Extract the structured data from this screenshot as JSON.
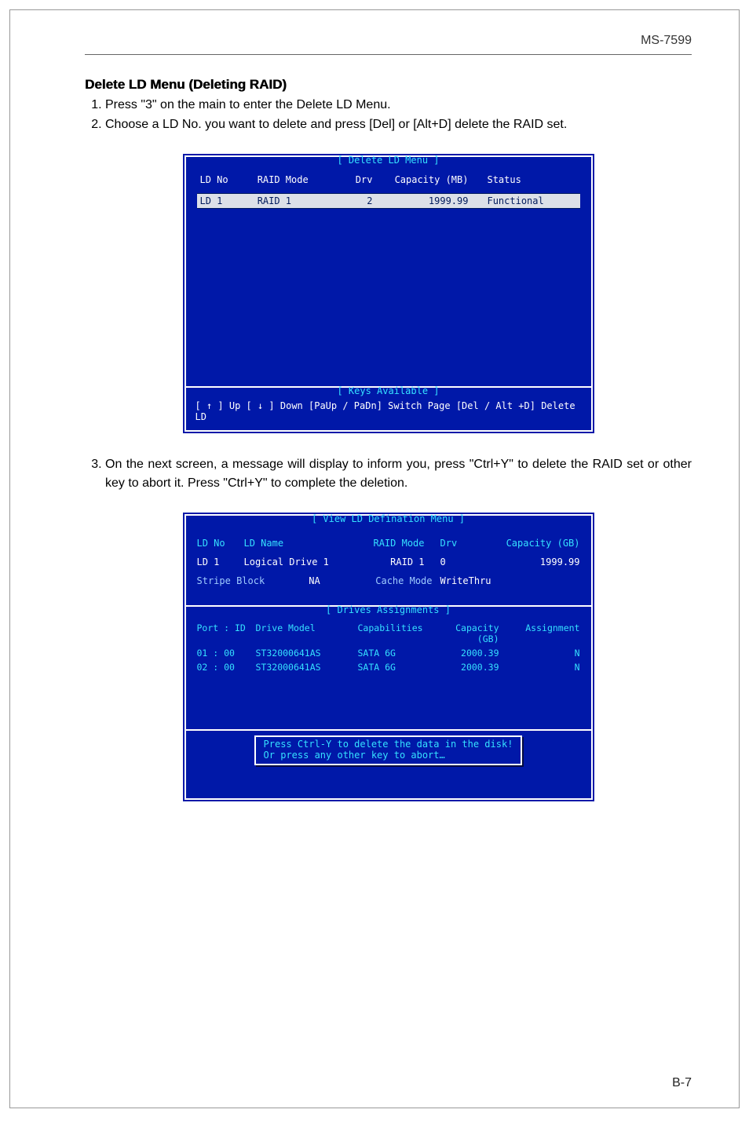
{
  "model": "MS-7599",
  "pageNumber": "B-7",
  "sectionTitle": "Delete LD Menu (Deleting RAID)",
  "steps": {
    "s1": "Press \"3\" on the main to enter the Delete LD Menu.",
    "s2": "Choose a LD No. you want to delete and press [Del] or [Alt+D] delete the RAID set.",
    "s3": "On the next screen, a message will display to inform you, press \"Ctrl+Y\" to delete the RAID set or other key to abort it. Press \"Ctrl+Y\" to complete the deletion."
  },
  "bios1": {
    "title": "[ Delete LD Menu ]",
    "headers": {
      "h1": "LD No",
      "h2": "RAID Mode",
      "h3": "Drv",
      "h4": "Capacity (MB)",
      "h5": "Status"
    },
    "row1": {
      "c1": "LD   1",
      "c2": "RAID 1",
      "c3": "2",
      "c4": "1999.99",
      "c5": "Functional"
    },
    "keysTitle": "[ Keys Available ]",
    "keys": "[ ↑ ] Up    [ ↓ ] Down    [PaUp / PaDn] Switch Page    [Del / Alt +D] Delete LD"
  },
  "bios2": {
    "title": "[ View LD Defination Menu ]",
    "top": {
      "hdr": {
        "c1": "LD No",
        "c2": "LD Name",
        "c3": "RAID Mode",
        "c4": "Drv",
        "c5": "Capacity (GB)"
      },
      "row1": {
        "c1": "LD   1",
        "c2": "Logical Drive 1",
        "c3": "RAID 1",
        "c4": "0",
        "c5": "1999.99"
      },
      "row2": {
        "c1": "Stripe Block",
        "c2": "NA",
        "c3": "Cache Mode",
        "c4": "WriteThru",
        "c5": ""
      }
    },
    "midTitle": "[ Drives Assignments ]",
    "mid": {
      "hdr": {
        "d1": "Port : ID",
        "d2": "Drive Model",
        "d3": "Capabilities",
        "d4": "Capacity (GB)",
        "d5": "Assignment"
      },
      "r1": {
        "d1": "01 : 00",
        "d2": "ST32000641AS",
        "d3": "SATA 6G",
        "d4": "2000.39",
        "d5": "N"
      },
      "r2": {
        "d1": "02 : 00",
        "d2": "ST32000641AS",
        "d3": "SATA 6G",
        "d4": "2000.39",
        "d5": "N"
      }
    },
    "dialog": {
      "l1": "Press Ctrl-Y to delete the data in the disk!",
      "l2": "Or press any other key to abort…"
    }
  }
}
